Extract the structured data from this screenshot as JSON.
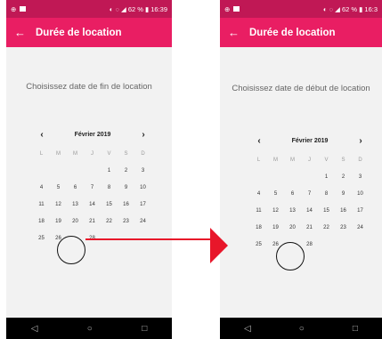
{
  "left": {
    "status": {
      "left_icons": "⊕",
      "right_text": "◐ ◌ ◢ 62 % ▮ 16:39"
    },
    "appbar": {
      "back_icon": "←",
      "title": "Durée de location"
    },
    "prompt": "Choisissez date de fin de location",
    "calendar": {
      "prev": "‹",
      "next": "›",
      "month": "Février 2019",
      "selected": "27"
    }
  },
  "right": {
    "status": {
      "left_icons": "⊕",
      "right_text": "◐ ◌ ◢ 62 % ▮ 16:3"
    },
    "appbar": {
      "back_icon": "←",
      "title": "Durée de location"
    },
    "prompt": "Choisissez date de début de location",
    "calendar": {
      "prev": "‹",
      "next": "›",
      "month": "Février 2019",
      "selected": "27"
    }
  },
  "weekdays": [
    "L",
    "M",
    "M",
    "J",
    "V",
    "S",
    "D"
  ],
  "days": [
    "",
    "",
    "",
    "",
    "1",
    "2",
    "3",
    "4",
    "5",
    "6",
    "7",
    "8",
    "9",
    "10",
    "11",
    "12",
    "13",
    "14",
    "15",
    "16",
    "17",
    "18",
    "19",
    "20",
    "21",
    "22",
    "23",
    "24",
    "25",
    "26",
    "27",
    "28"
  ],
  "navbar": {
    "back": "◁",
    "home": "○",
    "recents": "□"
  },
  "colors": {
    "accent": "#e91e63",
    "status": "#c01855",
    "arrow": "#e8162a"
  }
}
